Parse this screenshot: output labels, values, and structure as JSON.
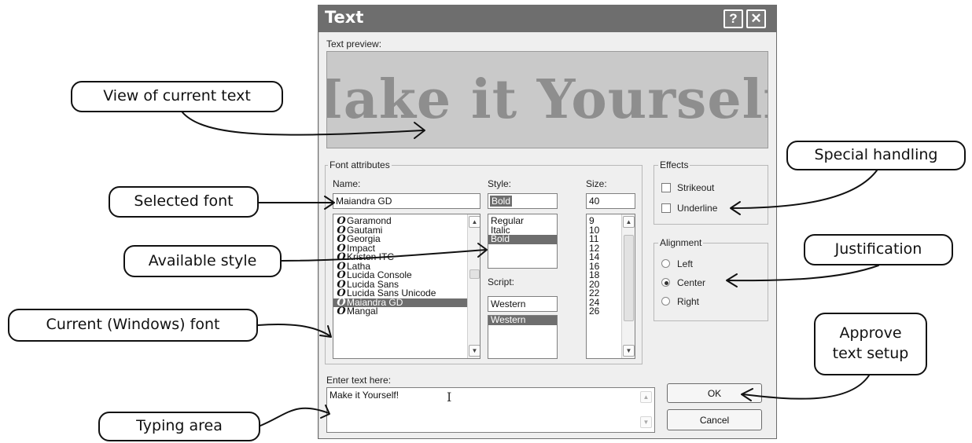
{
  "dialog": {
    "title": "Text",
    "help_button": "?",
    "close_button": "✕",
    "preview_label": "Text preview:",
    "preview_text": "Make it Yourself!",
    "font_attributes": {
      "legend": "Font attributes",
      "name_label": "Name:",
      "name_value": "Maiandra GD",
      "fonts": [
        "Garamond",
        "Gautami",
        "Georgia",
        "Impact",
        "Kristen ITC",
        "Latha",
        "Lucida Console",
        "Lucida Sans",
        "Lucida Sans Unicode",
        "Maiandra GD",
        "Mangal"
      ],
      "selected_font": "Maiandra GD",
      "font_icon_glyph": "O",
      "style_label": "Style:",
      "style_value": "Bold",
      "styles": [
        "Regular",
        "Italic",
        "Bold"
      ],
      "script_label": "Script:",
      "script_value": "Western",
      "scripts": [
        "Western"
      ],
      "size_label": "Size:",
      "size_value": "40",
      "sizes": [
        "9",
        "10",
        "11",
        "12",
        "14",
        "16",
        "18",
        "20",
        "22",
        "24",
        "26"
      ]
    },
    "effects": {
      "legend": "Effects",
      "strikeout": "Strikeout",
      "underline": "Underline"
    },
    "alignment": {
      "legend": "Alignment",
      "left": "Left",
      "center": "Center",
      "right": "Right",
      "selected": "Center"
    },
    "enter_text_label": "Enter text here:",
    "entered_text": "Make it Yourself!",
    "ok_label": "OK",
    "cancel_label": "Cancel"
  },
  "callouts": {
    "view_current_text": "View of current text",
    "selected_font": "Selected font",
    "available_style": "Available style",
    "current_windows_font": "Current (Windows) font",
    "typing_area": "Typing area",
    "special_handling": "Special handling",
    "justification": "Justification",
    "approve_text_setup_line1": "Approve",
    "approve_text_setup_line2": "text setup"
  },
  "colors": {
    "titlebar": "#6e6e6e",
    "preview_bg": "#c9c9c9",
    "preview_text": "#8e8e8e",
    "selection": "#6e6e6e",
    "dialog_bg": "#efefef"
  }
}
